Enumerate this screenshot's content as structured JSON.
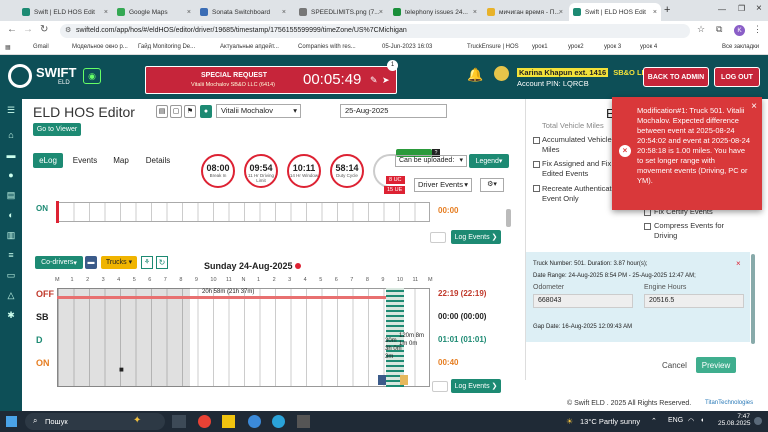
{
  "browser": {
    "tabs": [
      "Swift | ELD HOS Edit",
      "Google Maps",
      "Sonata Switchboard",
      "SPEEDLIMITS.png (7...",
      "telephony issues 24...",
      "мичиган время - П...",
      "Swift | ELD HOS Edit"
    ],
    "new_tab": "+",
    "url": "swifteld.com/app/hos/#/eldHOS/editor/driver/19685/timestamp/1756155599999/timeZone/US%7CMichigan",
    "bookmarks": [
      "Gmail",
      "Модельное окно р...",
      "Гайд Monitoring De...",
      "Актуальные апдейт...",
      "Companies with res...",
      "05-Jun-2023 16:03",
      "TruckEnsure | HOS",
      "урок1",
      "урок2",
      "урок 3",
      "урок 4"
    ],
    "all_bookmarks": "Все закладки",
    "profile": "K"
  },
  "header": {
    "logo": "SWIFT",
    "logo_sub": "ELD",
    "special_title": "SPECIAL REQUEST",
    "special_sub": "Vitalii Mochalov  SB&O LLC (6414)",
    "timer": "00:05:49",
    "notif_count": "1",
    "user_name": "Karina Khapun ext. 1416",
    "company": "SB&O LLC",
    "account_pin": "Account PIN: LQRCB",
    "back_to_admin": "BACK TO ADMIN",
    "logout": "LOG OUT"
  },
  "editor": {
    "title": "ELD HOS Editor",
    "driver": "Vitalii Mochalov",
    "date": "25-Aug-2025",
    "go_to_viewer": "Go to Viewer",
    "tabs": [
      "eLog",
      "Events",
      "Map",
      "Details"
    ],
    "circles": [
      {
        "value": "08:00",
        "label": "Break In"
      },
      {
        "value": "09:54",
        "label": "11 Hr Driving Limit"
      },
      {
        "value": "10:11",
        "label": "14 Hr Window"
      },
      {
        "value": "58:14",
        "label": "Duty Cycle"
      }
    ],
    "uc_badge": "8 UC",
    "ue_badge": "15 UE",
    "can_be_uploaded": "Can be uploaded:",
    "legend": "Legend",
    "driver_events": "Driver Events",
    "on_label": "ON",
    "on_time": "00:00",
    "log_events": "Log Events",
    "codrivers": "Co-drivers",
    "trucks": "Trucks",
    "day_title": "Sunday 24-Aug-2025",
    "hour_ticks": [
      "M",
      "1",
      "2",
      "3",
      "4",
      "5",
      "6",
      "7",
      "8",
      "9",
      "10",
      "11",
      "N",
      "1",
      "2",
      "3",
      "4",
      "5",
      "6",
      "7",
      "8",
      "9",
      "10",
      "11",
      "M"
    ],
    "rows": [
      {
        "label": "OFF",
        "time": "22:19 (22:19)",
        "color": "#c0392b"
      },
      {
        "label": "SB",
        "time": "00:00 (00:00)",
        "color": "#222"
      },
      {
        "label": "D",
        "time": "01:01 (01:01)",
        "color": "#1d8a73"
      },
      {
        "label": "ON",
        "time": "00:40",
        "color": "#e67e22"
      }
    ],
    "off_annotation": "20h 58m (21h 37m)",
    "chart_notes": [
      "30m",
      "3h 0m",
      "3m",
      "120m 8m",
      "1m 0m"
    ]
  },
  "panel": {
    "items": [
      "Total Vehicle Miles",
      "Accumulated Vehicle Miles",
      "Fix Assigned and Fix Edited Events",
      "Recreate Authenticated Event Only",
      "Fix Certify Events",
      "Compress Events for Driving"
    ],
    "truck_info": "Truck Number: 501. Duration: 3.87 hour(s);",
    "date_range": "Date Range: 24-Aug-2025 8:54 PM - 25-Aug-2025 12:47 AM;",
    "odometer_label": "Odometer",
    "odometer_value": "668043",
    "engine_hours_label": "Engine Hours",
    "engine_hours_value": "20516.5",
    "gap_date": "Gap Date: 16-Aug-2025 12:09:43 AM",
    "cancel": "Cancel",
    "preview": "Preview"
  },
  "toast": {
    "message": "Modification#1: Truck 501. Vitalii Mochalov. Expected difference between event at 2025-08-24 20:54:02 and event at 2025-08-24 20:58:18 is 1.00 miles. You have to set longer range with movement events (Driving, PC or YM).",
    "close": "×"
  },
  "footer": {
    "copyright": "© Swift ELD . 2025 All Rights Reserved.",
    "brand": "TitanTechnologies"
  },
  "taskbar": {
    "search": "Пошук",
    "weather": "13°C Partly sunny",
    "lang": "ENG",
    "time": "7:47",
    "date": "25.08.2025"
  }
}
